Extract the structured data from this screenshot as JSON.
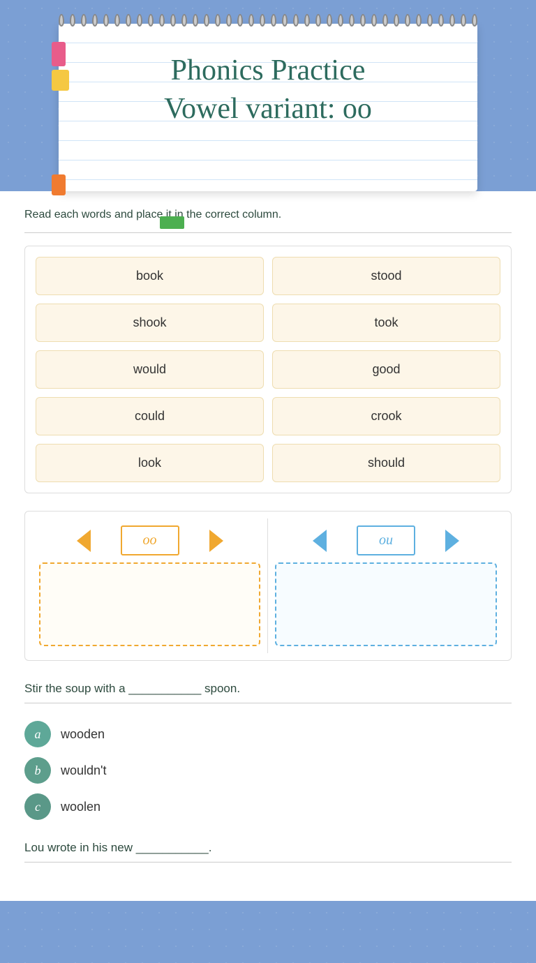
{
  "header": {
    "title_line1": "Phonics Practice",
    "title_line2": "Vowel variant: oo"
  },
  "section1": {
    "instruction": "Read each words and place it in the correct column.",
    "words": [
      {
        "id": "w1",
        "text": "book"
      },
      {
        "id": "w2",
        "text": "stood"
      },
      {
        "id": "w3",
        "text": "shook"
      },
      {
        "id": "w4",
        "text": "took"
      },
      {
        "id": "w5",
        "text": "would"
      },
      {
        "id": "w6",
        "text": "good"
      },
      {
        "id": "w7",
        "text": "could"
      },
      {
        "id": "w8",
        "text": "crook"
      },
      {
        "id": "w9",
        "text": "look"
      },
      {
        "id": "w10",
        "text": "should"
      }
    ]
  },
  "section2": {
    "col1_label": "oo",
    "col2_label": "ou"
  },
  "section3": {
    "sentence": "Stir the soup with a ___________ spoon.",
    "choices": [
      {
        "badge": "a",
        "text": "wooden"
      },
      {
        "badge": "b",
        "text": "wouldn't"
      },
      {
        "badge": "c",
        "text": "woolen"
      }
    ]
  },
  "section4": {
    "sentence": "Lou wrote in his new ___________."
  }
}
